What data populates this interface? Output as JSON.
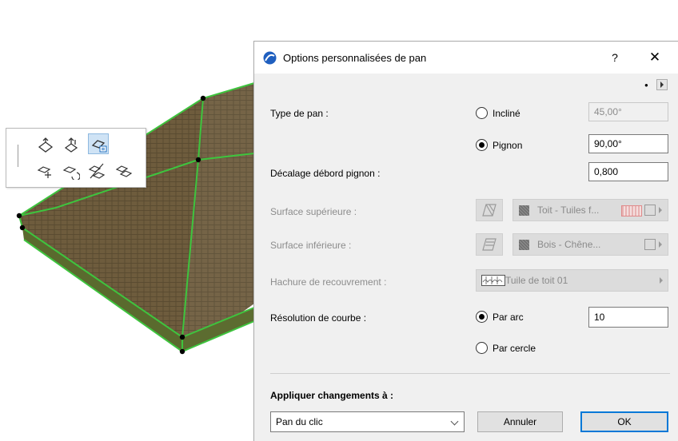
{
  "dialog": {
    "title": "Options personnalisées de pan",
    "help": "?",
    "close": "✕",
    "pan_type": {
      "label": "Type de pan :",
      "option_incline": "Incliné",
      "incline_value": "45,00°",
      "option_pignon": "Pignon",
      "pignon_value": "90,00°",
      "selected": "Pignon"
    },
    "gable_offset": {
      "label": "Décalage débord pignon :",
      "value": "0,800"
    },
    "top_surface": {
      "label": "Surface supérieure :",
      "value": "Toit - Tuiles f..."
    },
    "bottom_surface": {
      "label": "Surface inférieure :",
      "value": "Bois - Chêne..."
    },
    "cover_fill": {
      "label": "Hachure de recouvrement :",
      "value": "Tuile de toit 01"
    },
    "curve_resolution": {
      "label": "Résolution de courbe :",
      "option_arc": "Par arc",
      "arc_value": "10",
      "option_circle": "Par cercle",
      "selected": "Par arc"
    },
    "apply": {
      "label": "Appliquer changements à :",
      "value": "Pan du clic"
    },
    "cancel": "Annuler",
    "ok": "OK"
  },
  "palette": {
    "tools": [
      "tilt-roof-icon",
      "elevate-roof-icon",
      "custom-plane-icon",
      "offset-edge-icon",
      "rotate-edge-icon",
      "split-plane-icon",
      "merge-plane-icon"
    ],
    "selected_tool": "custom-plane-icon"
  },
  "colors": {
    "roof": "#6b5a3a",
    "selection_edge": "#3ec43e",
    "accent": "#0078d7"
  }
}
